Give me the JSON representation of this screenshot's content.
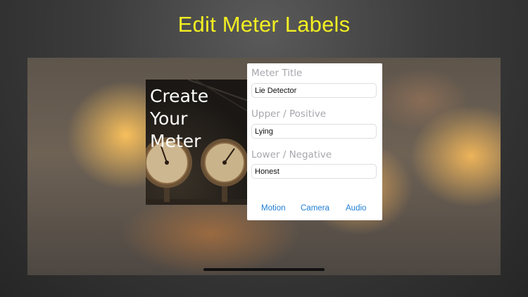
{
  "headline": "Edit Meter Labels",
  "meter_card": {
    "title": "Create Your Meter"
  },
  "form": {
    "meter_title": {
      "label": "Meter Title",
      "value": "Lie Detector"
    },
    "upper": {
      "label": "Upper / Positive",
      "value": "Lying"
    },
    "lower": {
      "label": "Lower / Negative",
      "value": "Honest"
    }
  },
  "modes": [
    "Motion",
    "Camera",
    "Audio"
  ],
  "colors": {
    "headline": "#f2ee22",
    "accent": "#1e7ed6",
    "field_label": "#a7a7ad"
  }
}
